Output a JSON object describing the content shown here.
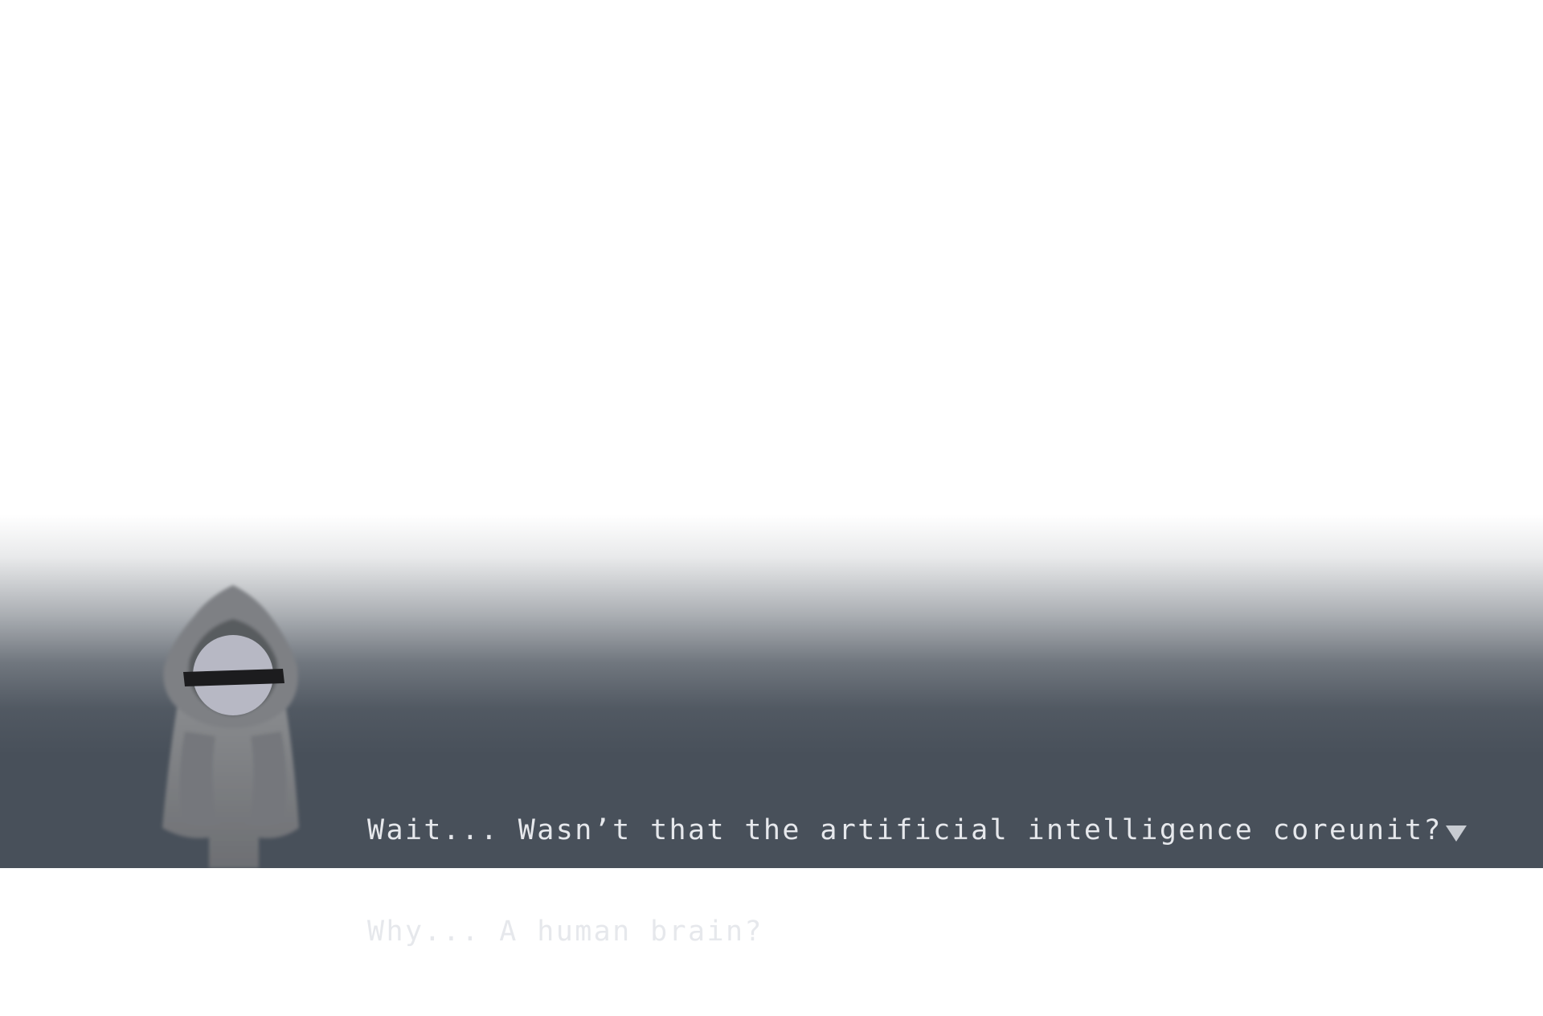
{
  "scene": {
    "background_color": "#ffffff",
    "dialog_band_color": "#48505a"
  },
  "speaker": {
    "portrait_icon": "hooded-figure-icon"
  },
  "dialog": {
    "lines": [
      "Wait... Wasn’t that the artificial intelligence coreunit?",
      "Why... A human brain?"
    ],
    "text_color": "#e6e8ec"
  },
  "continue_indicator": {
    "icon": "down-triangle-icon",
    "color": "#c8ccd2"
  }
}
